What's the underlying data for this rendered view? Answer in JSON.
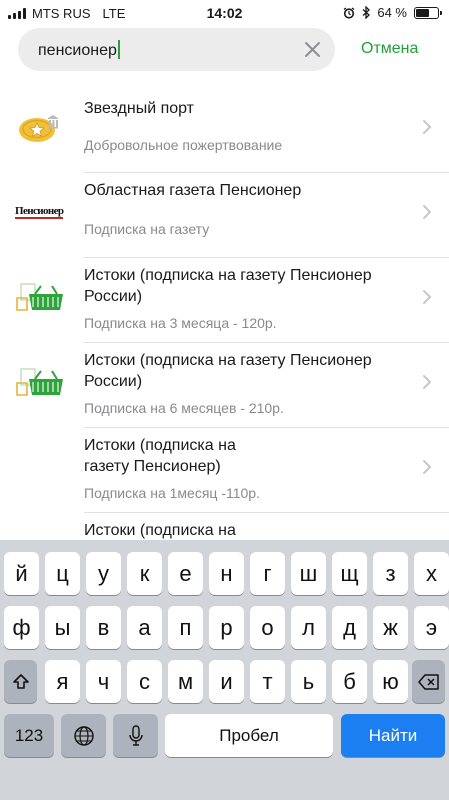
{
  "status_bar": {
    "carrier": "MTS RUS",
    "network": "LTE",
    "time": "14:02",
    "battery_percent": "64 %",
    "battery_level": 0.64
  },
  "search": {
    "query": "пенсионер",
    "cancel_label": "Отмена"
  },
  "results": [
    {
      "title": "Звездный порт",
      "subtitle": "Добровольное пожертвование",
      "logo": "star-port-coin-logo"
    },
    {
      "title": "Областная газета Пенсионер",
      "subtitle": "Подписка на газету",
      "logo": "pensioner-newspaper-logo",
      "logo_text": "Пенсионер"
    },
    {
      "title": "Истоки (подписка на газету Пенсионер России)",
      "subtitle": "Подписка на 3 месяца - 120р.",
      "logo": "shopping-basket-logo"
    },
    {
      "title": "Истоки (подписка на газету Пенсионер России)",
      "subtitle": "Подписка на 6 месяцев - 210р.",
      "logo": "shopping-basket-logo"
    },
    {
      "title": "Истоки (подписка на газету Пенсионер)",
      "subtitle": "Подписка на 1месяц -110р.",
      "logo": "none"
    },
    {
      "title": "Истоки (подписка на газету Пенсионер)",
      "subtitle": "",
      "logo": "none"
    }
  ],
  "keyboard": {
    "row1": [
      "й",
      "ц",
      "у",
      "к",
      "е",
      "н",
      "г",
      "ш",
      "щ",
      "з",
      "х"
    ],
    "row2": [
      "ф",
      "ы",
      "в",
      "а",
      "п",
      "р",
      "о",
      "л",
      "д",
      "ж",
      "э"
    ],
    "row3": [
      "я",
      "ч",
      "с",
      "м",
      "и",
      "т",
      "ь",
      "б",
      "ю"
    ],
    "numbers_label": "123",
    "space_label": "Пробел",
    "go_label": "Найти",
    "shift_icon": "shift-arrow-icon",
    "backspace_icon": "backspace-icon",
    "globe_icon": "globe-icon",
    "mic_icon": "microphone-icon"
  },
  "colors": {
    "accent_green": "#21a038",
    "go_blue": "#1b7ff2",
    "keyboard_bg": "#d1d4d9"
  }
}
